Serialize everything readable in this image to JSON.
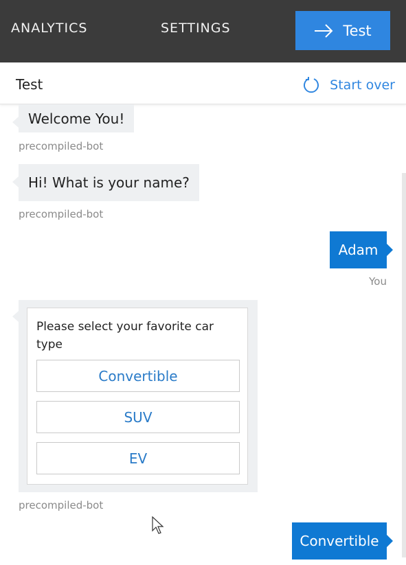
{
  "topbar": {
    "nav": [
      "ANALYTICS",
      "SETTINGS"
    ],
    "test_button": "Test"
  },
  "subheader": {
    "title": "Test",
    "start_over": "Start over"
  },
  "messages": [
    {
      "from": "bot",
      "text": "Welcome You!",
      "sender": "precompiled-bot"
    },
    {
      "from": "bot",
      "text": "Hi! What is your name?",
      "sender": "precompiled-bot"
    },
    {
      "from": "user",
      "text": "Adam",
      "sender": "You"
    },
    {
      "from": "bot-card",
      "sender": "precompiled-bot"
    },
    {
      "from": "user",
      "text": "Convertible"
    }
  ],
  "card": {
    "prompt": "Please select your favorite car type",
    "choices": [
      "Convertible",
      "SUV",
      "EV"
    ]
  },
  "colors": {
    "topbar_bg": "#3b3b3b",
    "accent": "#2f86e0",
    "user_bubble": "#0f79d3",
    "bot_bubble": "#eef0f2"
  }
}
